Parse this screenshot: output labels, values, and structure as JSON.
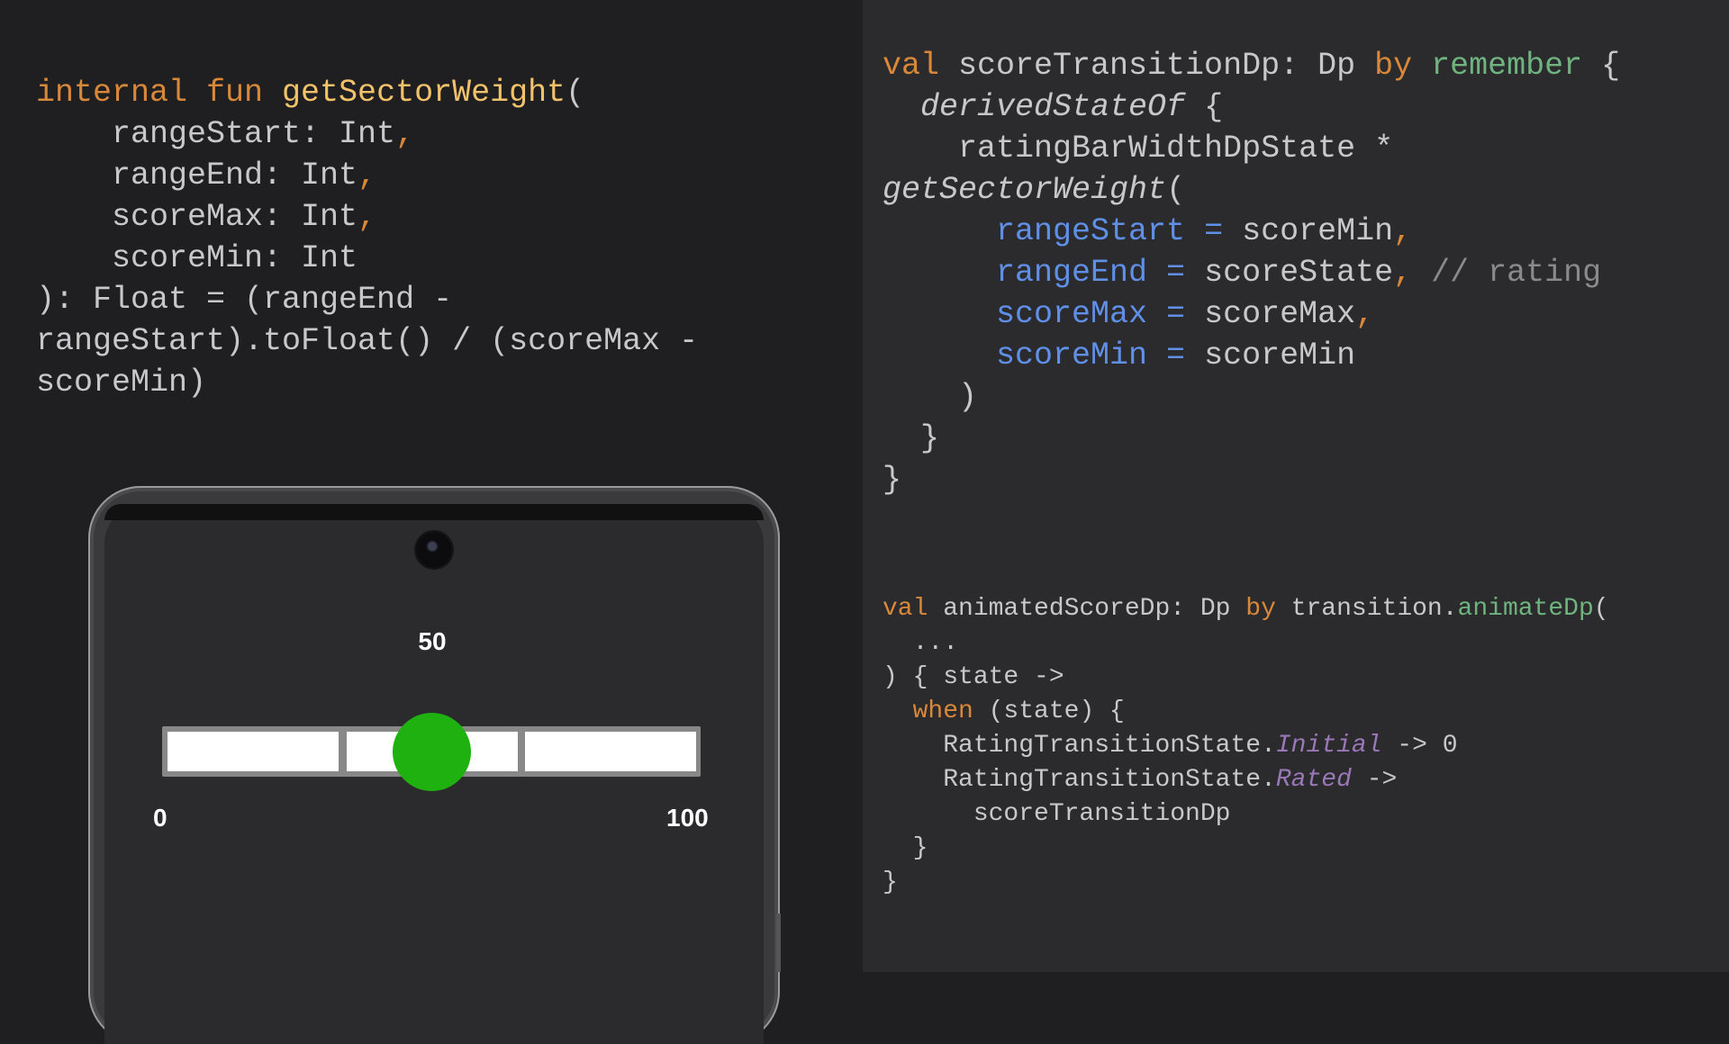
{
  "code_left": {
    "lines": [
      [
        {
          "t": "internal fun ",
          "c": "kw"
        },
        {
          "t": "getSectorWeight",
          "c": "fn"
        },
        {
          "t": "(",
          "c": ""
        }
      ],
      [
        {
          "t": "    rangeStart: Int",
          "c": ""
        },
        {
          "t": ",",
          "c": "pu"
        }
      ],
      [
        {
          "t": "    rangeEnd: Int",
          "c": ""
        },
        {
          "t": ",",
          "c": "pu"
        }
      ],
      [
        {
          "t": "    scoreMax: Int",
          "c": ""
        },
        {
          "t": ",",
          "c": "pu"
        }
      ],
      [
        {
          "t": "    scoreMin: Int",
          "c": ""
        }
      ],
      [
        {
          "t": "): Float = (rangeEnd -",
          "c": ""
        }
      ],
      [
        {
          "t": "rangeStart).toFloat() / (scoreMax -",
          "c": ""
        }
      ],
      [
        {
          "t": "scoreMin)",
          "c": ""
        }
      ]
    ]
  },
  "code_right_top": {
    "lines": [
      [
        {
          "t": "val ",
          "c": "kw"
        },
        {
          "t": "scoreTransitionDp: Dp ",
          "c": ""
        },
        {
          "t": "by ",
          "c": "kw"
        },
        {
          "t": "remember",
          "c": "gr"
        },
        {
          "t": " {",
          "c": ""
        }
      ],
      [
        {
          "t": "  ",
          "c": ""
        },
        {
          "t": "derivedStateOf",
          "c": "it"
        },
        {
          "t": " {",
          "c": ""
        }
      ],
      [
        {
          "t": "    ratingBarWidthDpState *",
          "c": ""
        }
      ],
      [
        {
          "t": "getSectorWeight",
          "c": "it"
        },
        {
          "t": "(",
          "c": ""
        }
      ],
      [
        {
          "t": "      ",
          "c": ""
        },
        {
          "t": "rangeStart = ",
          "c": "pa"
        },
        {
          "t": "scoreMin",
          "c": ""
        },
        {
          "t": ",",
          "c": "pu"
        }
      ],
      [
        {
          "t": "      ",
          "c": ""
        },
        {
          "t": "rangeEnd = ",
          "c": "pa"
        },
        {
          "t": "scoreState",
          "c": ""
        },
        {
          "t": ", ",
          "c": "pu"
        },
        {
          "t": "// rating",
          "c": "cm"
        }
      ],
      [
        {
          "t": "      ",
          "c": ""
        },
        {
          "t": "scoreMax = ",
          "c": "pa"
        },
        {
          "t": "scoreMax",
          "c": ""
        },
        {
          "t": ",",
          "c": "pu"
        }
      ],
      [
        {
          "t": "      ",
          "c": ""
        },
        {
          "t": "scoreMin = ",
          "c": "pa"
        },
        {
          "t": "scoreMin",
          "c": ""
        }
      ],
      [
        {
          "t": "    )",
          "c": ""
        }
      ],
      [
        {
          "t": "  }",
          "c": ""
        }
      ],
      [
        {
          "t": "}",
          "c": ""
        }
      ]
    ]
  },
  "code_right_bottom": {
    "lines": [
      [
        {
          "t": "val ",
          "c": "kw"
        },
        {
          "t": "animatedScoreDp: Dp ",
          "c": ""
        },
        {
          "t": "by ",
          "c": "kw"
        },
        {
          "t": "transition.",
          "c": ""
        },
        {
          "t": "animateDp",
          "c": "gr"
        },
        {
          "t": "(",
          "c": ""
        }
      ],
      [
        {
          "t": "  ...",
          "c": ""
        }
      ],
      [
        {
          "t": ") { state ->",
          "c": ""
        }
      ],
      [
        {
          "t": "  ",
          "c": ""
        },
        {
          "t": "when",
          "c": "kw"
        },
        {
          "t": " (state) {",
          "c": ""
        }
      ],
      [
        {
          "t": "    RatingTransitionState.",
          "c": ""
        },
        {
          "t": "Initial",
          "c": "ev"
        },
        {
          "t": " -> 0",
          "c": ""
        }
      ],
      [
        {
          "t": "    RatingTransitionState.",
          "c": ""
        },
        {
          "t": "Rated",
          "c": "ev"
        },
        {
          "t": " ->",
          "c": ""
        }
      ],
      [
        {
          "t": "      scoreTransitionDp",
          "c": ""
        }
      ],
      [
        {
          "t": "  }",
          "c": ""
        }
      ],
      [
        {
          "t": "}",
          "c": ""
        }
      ]
    ]
  },
  "phone": {
    "score_value": "50",
    "score_fraction": 0.5,
    "min_label": "0",
    "max_label": "100",
    "segment_count": 3,
    "thumb_color": "#1eb10f",
    "segment_color": "#ffffff",
    "bar_border_color": "#888888"
  }
}
